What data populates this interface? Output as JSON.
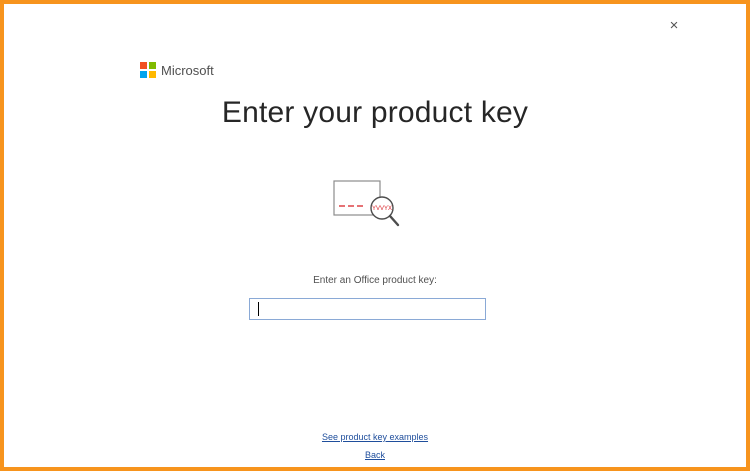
{
  "window": {
    "close_glyph": "×",
    "border_color": "#f7941d"
  },
  "brand": {
    "name": "Microsoft",
    "logo_colors": [
      "#f25022",
      "#7fba00",
      "#00a4ef",
      "#ffb900"
    ]
  },
  "page": {
    "title": "Enter your product key"
  },
  "illustration": {
    "key_fragment": "YVVYX"
  },
  "form": {
    "label": "Enter an Office product key:",
    "value": "",
    "placeholder": ""
  },
  "links": {
    "examples": "See product key examples",
    "back": "Back"
  },
  "colors": {
    "link": "#1f4e9c",
    "input_border": "#8aa9d6",
    "accent_red": "#d9262b"
  }
}
